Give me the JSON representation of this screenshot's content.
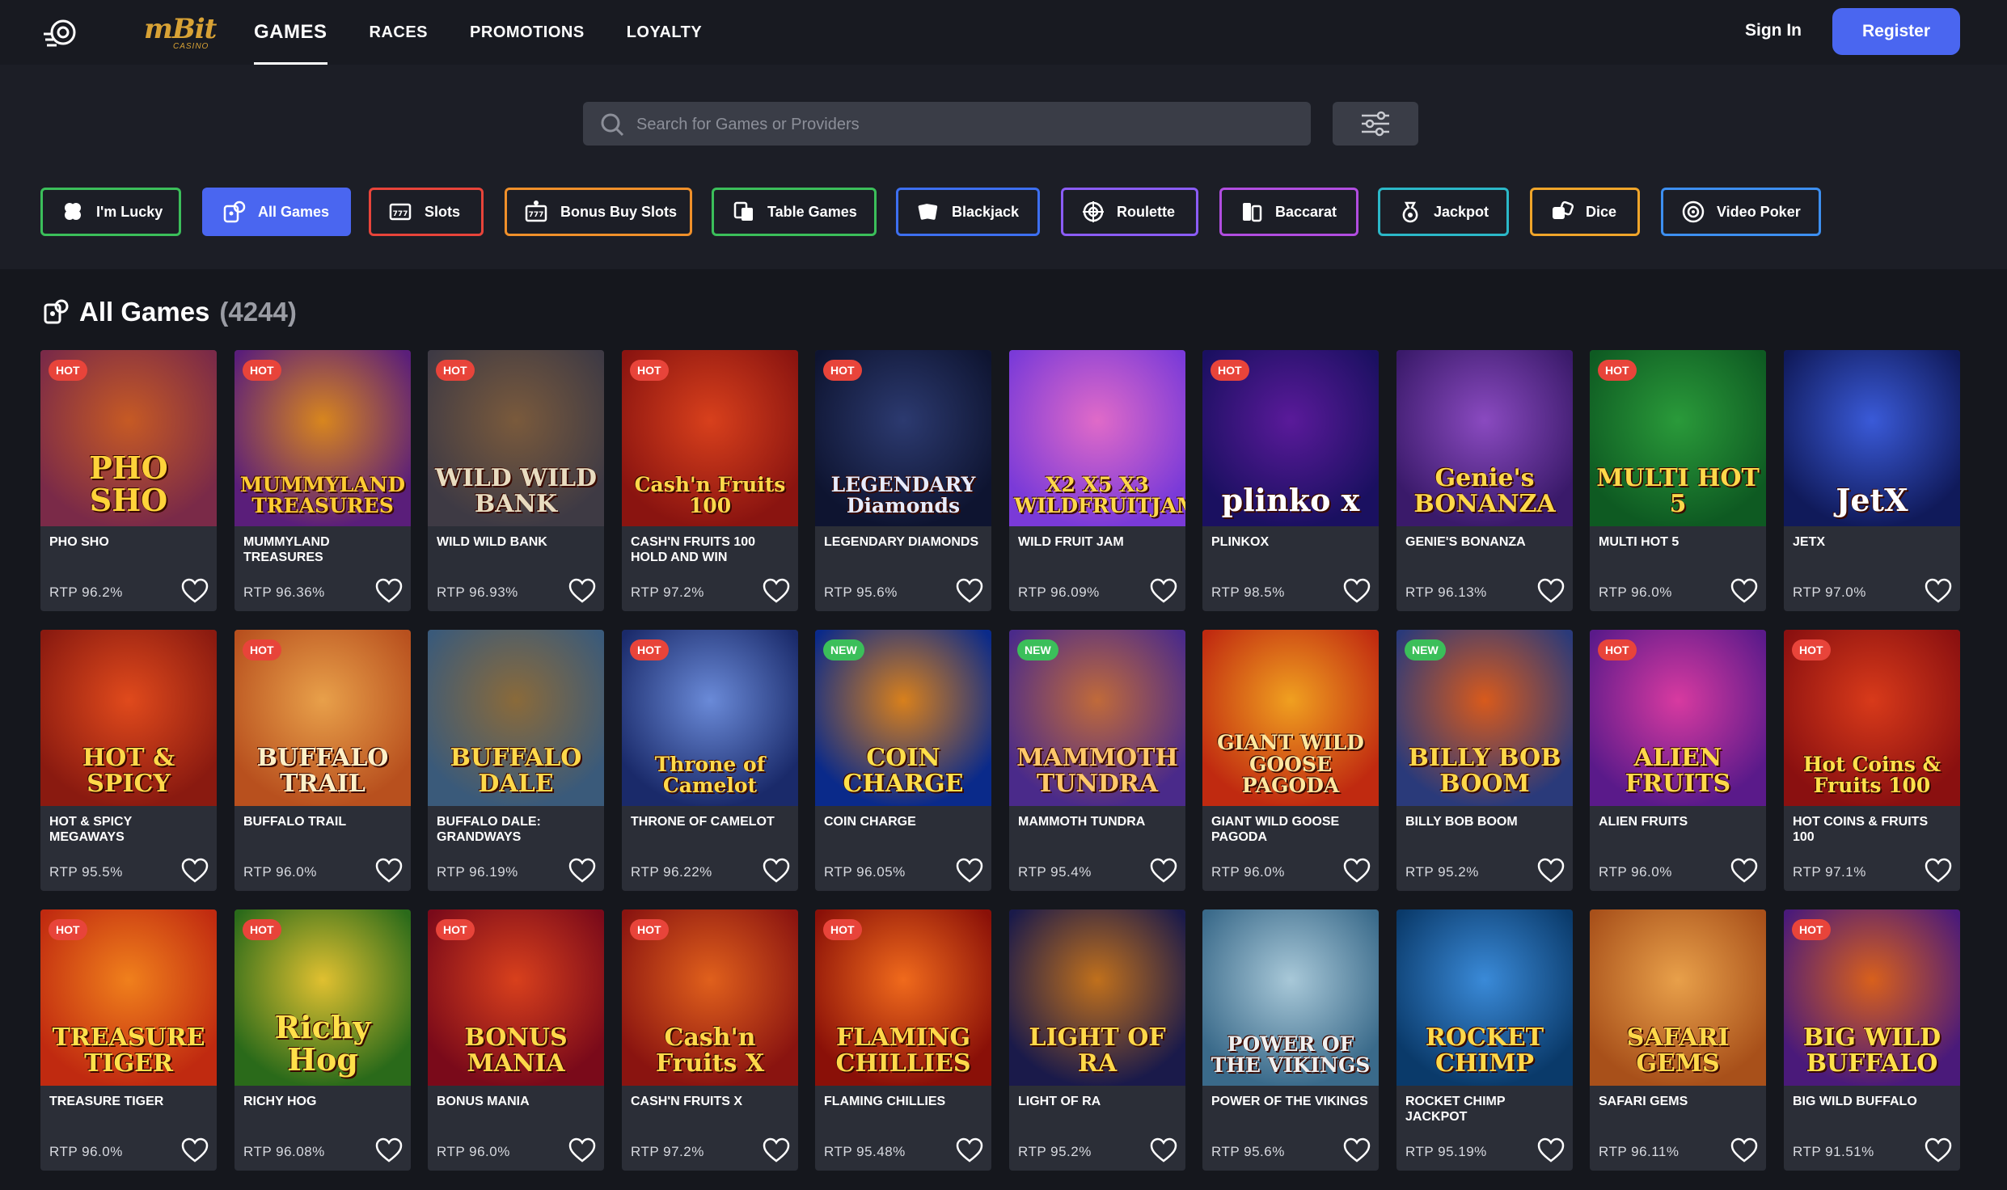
{
  "header": {
    "brand": "mBit",
    "brand_sub": "CASINO",
    "nav": [
      "GAMES",
      "RACES",
      "PROMOTIONS",
      "LOYALTY"
    ],
    "active_nav": "GAMES",
    "sign_in": "Sign In",
    "register": "Register"
  },
  "search": {
    "placeholder": "Search for Games or Providers",
    "value": ""
  },
  "categories": [
    {
      "label": "I'm Lucky",
      "icon": "clover-icon",
      "color": "#3bbf5a",
      "filled": false
    },
    {
      "label": "All Games",
      "icon": "games-icon",
      "color": "#4a66f0",
      "filled": true
    },
    {
      "label": "Slots",
      "icon": "slot-machine-icon",
      "color": "#e8443a",
      "filled": false
    },
    {
      "label": "Bonus Buy Slots",
      "icon": "bonus-slot-icon",
      "color": "#f0902a",
      "filled": false
    },
    {
      "label": "Table Games",
      "icon": "table-games-icon",
      "color": "#3bbf5a",
      "filled": false
    },
    {
      "label": "Blackjack",
      "icon": "cards-icon",
      "color": "#3d6ff0",
      "filled": false
    },
    {
      "label": "Roulette",
      "icon": "roulette-icon",
      "color": "#8b5cf6",
      "filled": false
    },
    {
      "label": "Baccarat",
      "icon": "baccarat-icon",
      "color": "#b14de0",
      "filled": false
    },
    {
      "label": "Jackpot",
      "icon": "money-bag-icon",
      "color": "#2bb8c8",
      "filled": false
    },
    {
      "label": "Dice",
      "icon": "dice-icon",
      "color": "#f0a52a",
      "filled": false
    },
    {
      "label": "Video Poker",
      "icon": "poker-chip-icon",
      "color": "#3d8ff0",
      "filled": false
    }
  ],
  "section": {
    "title": "All Games",
    "count": "(4244)"
  },
  "games": [
    {
      "title": "PHO SHO",
      "rtp": "RTP 96.2%",
      "badge": "HOT",
      "art": "PHO SHO",
      "bg1": "#7a2a48",
      "bg2": "#c65a24",
      "fg": "#ffd33a"
    },
    {
      "title": "MUMMYLAND TREASURES",
      "rtp": "RTP 96.36%",
      "badge": "HOT",
      "art": "MUMMYLAND TREASURES",
      "bg1": "#5a1e7a",
      "bg2": "#d8861e",
      "fg": "#ffcc33"
    },
    {
      "title": "WILD WILD BANK",
      "rtp": "RTP 96.93%",
      "badge": "HOT",
      "art": "WILD WILD BANK",
      "bg1": "#3e3a44",
      "bg2": "#7a5a3c",
      "fg": "#e8dcc0"
    },
    {
      "title": "CASH'N FRUITS 100 HOLD AND WIN",
      "rtp": "RTP 97.2%",
      "badge": "HOT",
      "art": "Cash'n Fruits 100",
      "bg1": "#8a1410",
      "bg2": "#d8401c",
      "fg": "#ffd84a"
    },
    {
      "title": "LEGENDARY DIAMONDS",
      "rtp": "RTP 95.6%",
      "badge": "HOT",
      "art": "LEGENDARY Diamonds",
      "bg1": "#0e1430",
      "bg2": "#2c3a70",
      "fg": "#e6ecff"
    },
    {
      "title": "WILD FRUIT JAM",
      "rtp": "RTP 96.09%",
      "badge": "",
      "art": "X2 X5 X3 WILDFRUITJAM",
      "bg1": "#7a3ad8",
      "bg2": "#e06ac8",
      "fg": "#ffd84a"
    },
    {
      "title": "PLINKOX",
      "rtp": "RTP 98.5%",
      "badge": "HOT",
      "art": "plinko x",
      "bg1": "#1a1060",
      "bg2": "#5a1a9a",
      "fg": "#ffffff"
    },
    {
      "title": "GENIE'S BONANZA",
      "rtp": "RTP 96.13%",
      "badge": "",
      "art": "Genie's BONANZA",
      "bg1": "#3a1a6a",
      "bg2": "#8a4ac0",
      "fg": "#ffd84a"
    },
    {
      "title": "MULTI HOT 5",
      "rtp": "RTP 96.0%",
      "badge": "HOT",
      "art": "MULTI HOT 5",
      "bg1": "#0e5a22",
      "bg2": "#2a9a3a",
      "fg": "#ffd84a"
    },
    {
      "title": "JETX",
      "rtp": "RTP 97.0%",
      "badge": "",
      "art": "JetX",
      "bg1": "#101a5a",
      "bg2": "#3a5ad8",
      "fg": "#ffffff"
    },
    {
      "title": "HOT & SPICY MEGAWAYS",
      "rtp": "RTP 95.5%",
      "badge": "",
      "art": "HOT & SPICY",
      "bg1": "#8a1a10",
      "bg2": "#e04a1c",
      "fg": "#ffd84a"
    },
    {
      "title": "BUFFALO TRAIL",
      "rtp": "RTP 96.0%",
      "badge": "HOT",
      "art": "BUFFALO TRAIL",
      "bg1": "#b8501e",
      "bg2": "#e8a04a",
      "fg": "#fff0c8"
    },
    {
      "title": "BUFFALO DALE: GRANDWAYS",
      "rtp": "RTP 96.19%",
      "badge": "",
      "art": "BUFFALO DALE",
      "bg1": "#3a5a7a",
      "bg2": "#8a6a3a",
      "fg": "#ffd84a"
    },
    {
      "title": "THRONE OF CAMELOT",
      "rtp": "RTP 96.22%",
      "badge": "HOT",
      "art": "Throne of Camelot",
      "bg1": "#1a2a6a",
      "bg2": "#6a8ad8",
      "fg": "#ffd84a"
    },
    {
      "title": "COIN CHARGE",
      "rtp": "RTP 96.05%",
      "badge": "NEW",
      "art": "COIN CHARGE",
      "bg1": "#0a2a8a",
      "bg2": "#d8801c",
      "fg": "#ffe04a"
    },
    {
      "title": "MAMMOTH TUNDRA",
      "rtp": "RTP 95.4%",
      "badge": "NEW",
      "art": "MAMMOTH TUNDRA",
      "bg1": "#4a2a8a",
      "bg2": "#c06a3a",
      "fg": "#ffc86a"
    },
    {
      "title": "GIANT WILD GOOSE PAGODA",
      "rtp": "RTP 96.0%",
      "badge": "",
      "art": "GIANT WILD GOOSE PAGODA",
      "bg1": "#c02a10",
      "bg2": "#f0a020",
      "fg": "#ffe8a0"
    },
    {
      "title": "BILLY BOB BOOM",
      "rtp": "RTP 95.2%",
      "badge": "NEW",
      "art": "BILLY BOB BOOM",
      "bg1": "#2a3a7a",
      "bg2": "#d85a1c",
      "fg": "#ffd84a"
    },
    {
      "title": "ALIEN FRUITS",
      "rtp": "RTP 96.0%",
      "badge": "HOT",
      "art": "ALIEN FRUITS",
      "bg1": "#5a1a8a",
      "bg2": "#d83aa0",
      "fg": "#ffd84a"
    },
    {
      "title": "HOT COINS & FRUITS 100",
      "rtp": "RTP 97.1%",
      "badge": "HOT",
      "art": "Hot Coins & Fruits 100",
      "bg1": "#8a1010",
      "bg2": "#d83a1a",
      "fg": "#ffe04a"
    },
    {
      "title": "TREASURE TIGER",
      "rtp": "RTP 96.0%",
      "badge": "HOT",
      "art": "TREASURE TIGER",
      "bg1": "#c02a10",
      "bg2": "#f0801c",
      "fg": "#ffe04a"
    },
    {
      "title": "RICHY HOG",
      "rtp": "RTP 96.08%",
      "badge": "HOT",
      "art": "Richy Hog",
      "bg1": "#2a6a1a",
      "bg2": "#e0c030",
      "fg": "#ffe04a"
    },
    {
      "title": "BONUS MANIA",
      "rtp": "RTP 96.0%",
      "badge": "HOT",
      "art": "BONUS MANIA",
      "bg1": "#7a0a1a",
      "bg2": "#d8401c",
      "fg": "#ffd84a"
    },
    {
      "title": "CASH'N FRUITS X",
      "rtp": "RTP 97.2%",
      "badge": "HOT",
      "art": "Cash'n Fruits X",
      "bg1": "#8a1410",
      "bg2": "#e0601c",
      "fg": "#ffd84a"
    },
    {
      "title": "FLAMING CHILLIES",
      "rtp": "RTP 95.48%",
      "badge": "HOT",
      "art": "FLAMING CHILLIES",
      "bg1": "#8a1008",
      "bg2": "#f06a1c",
      "fg": "#ffd84a"
    },
    {
      "title": "LIGHT OF RA",
      "rtp": "RTP 95.2%",
      "badge": "",
      "art": "LIGHT OF RA",
      "bg1": "#1a1a4a",
      "bg2": "#c0701c",
      "fg": "#ffd84a"
    },
    {
      "title": "POWER OF THE VIKINGS",
      "rtp": "RTP 95.6%",
      "badge": "",
      "art": "POWER OF THE VIKINGS",
      "bg1": "#3a6a8a",
      "bg2": "#a8c8d8",
      "fg": "#f0f0f0"
    },
    {
      "title": "ROCKET CHIMP JACKPOT",
      "rtp": "RTP 95.19%",
      "badge": "",
      "art": "ROCKET CHIMP",
      "bg1": "#0a3a6a",
      "bg2": "#3a8ad8",
      "fg": "#ffd84a"
    },
    {
      "title": "SAFARI GEMS",
      "rtp": "RTP 96.11%",
      "badge": "",
      "art": "SAFARI GEMS",
      "bg1": "#a8501a",
      "bg2": "#e8a04a",
      "fg": "#ffd84a"
    },
    {
      "title": "BIG WILD BUFFALO",
      "rtp": "RTP 91.51%",
      "badge": "HOT",
      "art": "BIG WILD BUFFALO",
      "bg1": "#4a1a7a",
      "bg2": "#d8601c",
      "fg": "#ffe04a"
    }
  ]
}
